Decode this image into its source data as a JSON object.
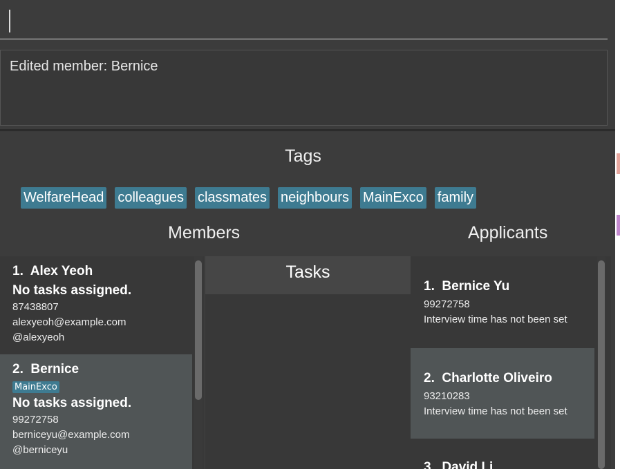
{
  "command_box": {
    "value": ""
  },
  "result_display": {
    "text": "Edited member: Bernice"
  },
  "tags": {
    "title": "Tags",
    "items": [
      "WelfareHead",
      "colleagues",
      "classmates",
      "neighbours",
      "MainExco",
      "family"
    ]
  },
  "members": {
    "title": "Members",
    "items": [
      {
        "index": "1.",
        "name": "Alex Yeoh",
        "tag": "",
        "tasks": "No tasks assigned.",
        "phone": "87438807",
        "email": "alexyeoh@example.com",
        "telegram": "@alexyeoh"
      },
      {
        "index": "2.",
        "name": "Bernice",
        "tag": "MainExco",
        "tasks": "No tasks assigned.",
        "phone": "99272758",
        "email": "berniceyu@example.com",
        "telegram": "@berniceyu"
      }
    ]
  },
  "tasks": {
    "title": "Tasks"
  },
  "applicants": {
    "title": "Applicants",
    "items": [
      {
        "index": "1.",
        "name": "Bernice Yu",
        "phone": "99272758",
        "interview": "Interview time has not been set"
      },
      {
        "index": "2.",
        "name": "Charlotte Oliveiro",
        "phone": "93210283",
        "interview": "Interview time has not been set"
      },
      {
        "index": "3.",
        "name": "David Li"
      }
    ]
  },
  "colors": {
    "background": "#3c3c3c",
    "panel": "#383838",
    "selected_card": "#505556",
    "tag": "#3e7b91"
  }
}
